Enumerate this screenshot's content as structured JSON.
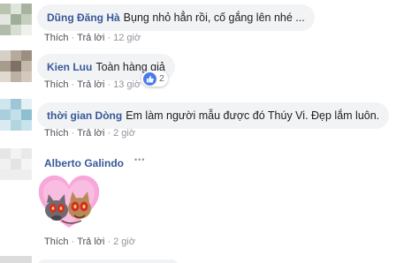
{
  "comments": [
    {
      "author": "Dũng Đăng Hà",
      "text": "Bụng nhỏ hẳn rồi, cố gắng lên nhé ...",
      "like_label": "Thích",
      "reply_label": "Trả lời",
      "time": "12 giờ"
    },
    {
      "author": "Kien Luu",
      "text": "Toàn hàng giả",
      "like_label": "Thích",
      "reply_label": "Trả lời",
      "time": "13 giờ",
      "reaction_count": "2"
    },
    {
      "author": "thời gian Dòng",
      "text": "Em làm người mẫu được đó Thúy Vi. Đẹp lắm luôn.",
      "like_label": "Thích",
      "reply_label": "Trả lời",
      "time": "2 giờ"
    },
    {
      "author": "Alberto Galindo",
      "text": "",
      "like_label": "Thích",
      "reply_label": "Trả lời",
      "time": "2 giờ",
      "sticker": "cats-in-heart-sticker"
    }
  ],
  "separator": "·",
  "more_options": "•••",
  "colors": {
    "author": "#385898",
    "bubble": "#f2f3f5",
    "like_badge": "#4a7ce8",
    "heart": "#f7a8d8"
  }
}
